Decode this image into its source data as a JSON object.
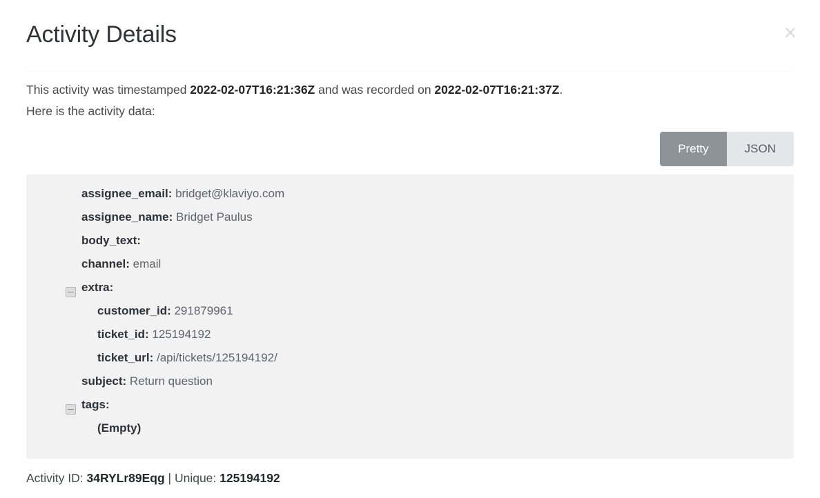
{
  "header": {
    "title": "Activity Details",
    "close_label": "×"
  },
  "intro": {
    "line1_prefix": "This activity was timestamped ",
    "timestamped_at": "2022-02-07T16:21:36Z",
    "line1_middle": " and was recorded on ",
    "recorded_at": "2022-02-07T16:21:37Z",
    "line1_suffix": ".",
    "line2": "Here is the activity data:"
  },
  "view_toggle": {
    "pretty_label": "Pretty",
    "json_label": "JSON",
    "selected": "Pretty",
    "active_bg": "#8c9399",
    "inactive_bg": "#e3e7ea"
  },
  "activity_data": [
    {
      "key": "assignee_email:",
      "value": "bridget@klaviyo.com",
      "indent": 1,
      "collapsible": false,
      "bold_value": false
    },
    {
      "key": "assignee_name:",
      "value": "Bridget Paulus",
      "indent": 1,
      "collapsible": false,
      "bold_value": false
    },
    {
      "key": "body_text:",
      "value": "",
      "indent": 1,
      "collapsible": false,
      "bold_value": false
    },
    {
      "key": "channel:",
      "value": "email",
      "indent": 1,
      "collapsible": false,
      "bold_value": false
    },
    {
      "key": "extra:",
      "value": "",
      "indent": 1,
      "collapsible": true,
      "bold_value": false
    },
    {
      "key": "customer_id:",
      "value": "291879961",
      "indent": 2,
      "collapsible": false,
      "bold_value": false
    },
    {
      "key": "ticket_id:",
      "value": "125194192",
      "indent": 2,
      "collapsible": false,
      "bold_value": false
    },
    {
      "key": "ticket_url:",
      "value": "/api/tickets/125194192/",
      "indent": 2,
      "collapsible": false,
      "bold_value": false
    },
    {
      "key": "subject:",
      "value": "Return question",
      "indent": 1,
      "collapsible": false,
      "bold_value": false
    },
    {
      "key": "tags:",
      "value": "",
      "indent": 1,
      "collapsible": true,
      "bold_value": false
    },
    {
      "key": "(Empty)",
      "value": "",
      "indent": 2,
      "collapsible": false,
      "bold_value": false
    }
  ],
  "footer": {
    "activity_id_label": "Activity ID: ",
    "activity_id": "34RYLr89Eqg",
    "separator": " | ",
    "unique_label": "Unique: ",
    "unique": "125194192"
  },
  "colors": {
    "panel_bg": "#f2f2f2",
    "key_text": "#2c3238",
    "value_text": "#5d646b"
  }
}
